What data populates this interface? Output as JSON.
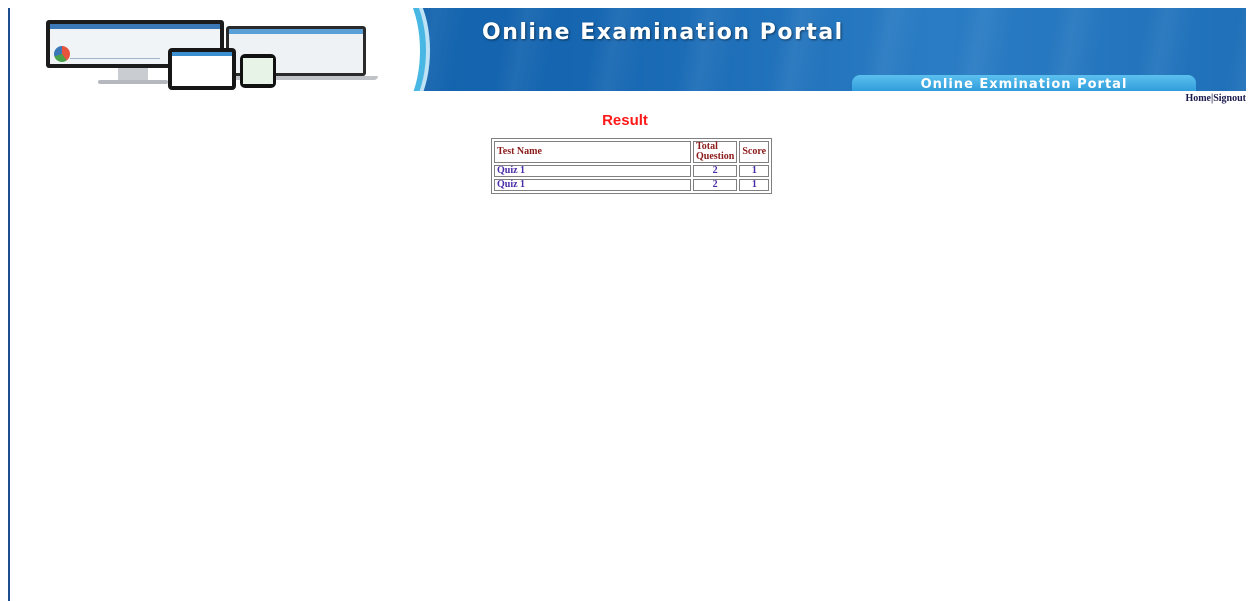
{
  "banner": {
    "title": "Online Examination Portal",
    "tab_label": "Online Exmination Portal",
    "colors": {
      "primary": "#1565b0",
      "accent": "#49b7e3"
    }
  },
  "nav": {
    "home": "Home",
    "separator": "|",
    "signout": "Signout"
  },
  "page": {
    "heading": "Result",
    "heading_color": "#ff1a1a"
  },
  "table": {
    "headers": [
      "Test Name",
      "Total Question",
      "Score"
    ],
    "rows": [
      {
        "test_name": "Quiz 1",
        "total_question": "2",
        "score": "1"
      },
      {
        "test_name": "Quiz 1",
        "total_question": "2",
        "score": "1"
      }
    ]
  }
}
